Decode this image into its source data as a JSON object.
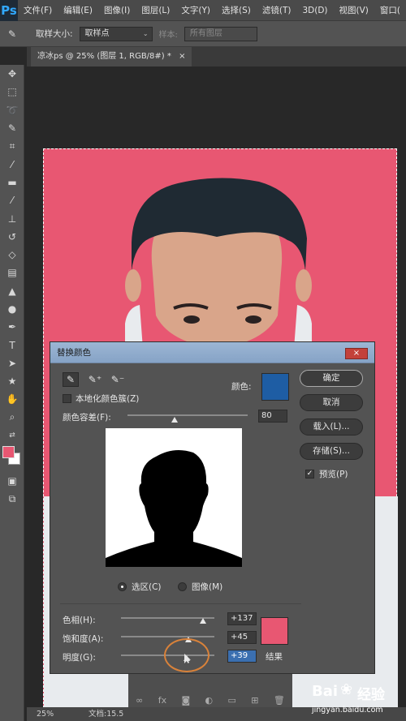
{
  "app": {
    "logo": "Ps"
  },
  "menubar": {
    "items": [
      "文件(F)",
      "编辑(E)",
      "图像(I)",
      "图层(L)",
      "文字(Y)",
      "选择(S)",
      "滤镜(T)",
      "3D(D)",
      "视图(V)",
      "窗口("
    ]
  },
  "options": {
    "sample_size_label": "取样大小:",
    "sample_size_value": "取样点",
    "sample_label": "样本:",
    "sample_value": "所有图层"
  },
  "document": {
    "tab_title": "凉冰ps @ 25% (图层 1, RGB/8#) *",
    "tab_close": "×",
    "zoom": "25%",
    "doc_info": "文档:15.5"
  },
  "colors": {
    "background": "#e85772",
    "fg_swatch": "#e85772",
    "bg_swatch": "#ffffff",
    "picked": "#1e5da4",
    "result": "#e85772",
    "accent": "#3b6fb0"
  },
  "dialog": {
    "title": "替换颜色",
    "close": "×",
    "localized_clusters_label": "本地化颜色簇(Z)",
    "color_label": "颜色:",
    "fuzziness_label": "颜色容差(F):",
    "fuzziness_value": "80",
    "fuzziness": 80,
    "selection_radio": "选区(C)",
    "image_radio": "图像(M)",
    "hue_label": "色相(H):",
    "hue_value": "+137",
    "hue": 137,
    "saturation_label": "饱和度(A):",
    "saturation_value": "+45",
    "saturation": 45,
    "lightness_label": "明度(G):",
    "lightness_value": "+39",
    "lightness": 39,
    "result_label": "结果",
    "buttons": {
      "ok": "确定",
      "cancel": "取消",
      "load": "载入(L)...",
      "save": "存储(S)..."
    },
    "preview_label": "预览(P)"
  },
  "watermark": {
    "text": "Bai",
    "text2": "经验",
    "url": "jingyan.baidu.com"
  },
  "icons": {
    "move": "move-icon",
    "marquee": "marquee-icon",
    "lasso": "lasso-icon",
    "quick_select": "quick-select-icon",
    "crop": "crop-icon",
    "eyedropper": "eyedropper-icon",
    "heal": "heal-icon",
    "brush": "brush-icon",
    "stamp": "stamp-icon",
    "history_brush": "history-brush-icon",
    "eraser": "eraser-icon",
    "gradient": "gradient-icon",
    "blur": "blur-icon",
    "dodge": "dodge-icon",
    "pen": "pen-icon",
    "type": "type-icon",
    "path_select": "path-select-icon",
    "shape": "shape-icon",
    "hand": "hand-icon",
    "zoom": "zoom-icon"
  }
}
